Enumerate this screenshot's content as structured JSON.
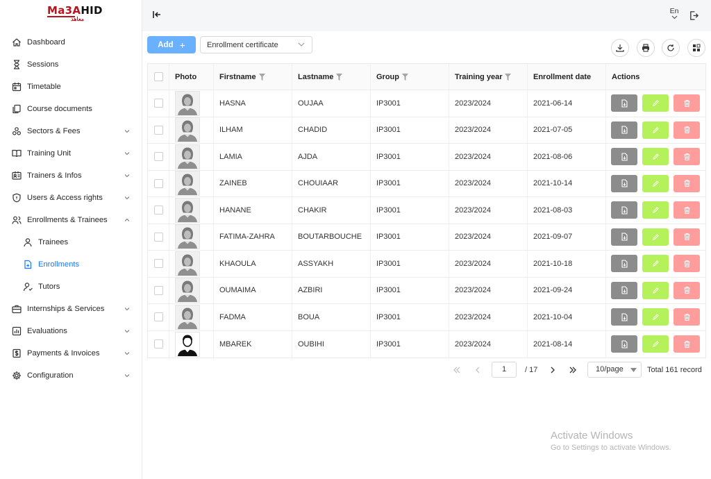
{
  "app": {
    "logo_text": "MA3AHID",
    "logo_arabic": "معاهد"
  },
  "sidebar": {
    "items": [
      {
        "label": "Dashboard",
        "icon": "home-icon",
        "expandable": false
      },
      {
        "label": "Sessions",
        "icon": "hourglass-icon",
        "expandable": false
      },
      {
        "label": "Timetable",
        "icon": "calendar-icon",
        "expandable": false
      },
      {
        "label": "Course documents",
        "icon": "documents-icon",
        "expandable": false
      },
      {
        "label": "Sectors & Fees",
        "icon": "clusters-icon",
        "expandable": true
      },
      {
        "label": "Training Unit",
        "icon": "book-icon",
        "expandable": true
      },
      {
        "label": "Trainers & Infos",
        "icon": "id-card-icon",
        "expandable": true
      },
      {
        "label": "Users & Access rights",
        "icon": "shield-icon",
        "expandable": true
      },
      {
        "label": "Enrollments & Trainees",
        "icon": "users-icon",
        "expandable": true,
        "expanded": true
      },
      {
        "label": "Trainees",
        "icon": "user-icon",
        "sub": true
      },
      {
        "label": "Enrollments",
        "icon": "enroll-icon",
        "sub": true,
        "active": true
      },
      {
        "label": "Tutors",
        "icon": "tutor-icon",
        "sub": true
      },
      {
        "label": "Internships & Services",
        "icon": "briefcase-icon",
        "expandable": true
      },
      {
        "label": "Evaluations",
        "icon": "chart-icon",
        "expandable": true
      },
      {
        "label": "Payments & Invoices",
        "icon": "dollar-icon",
        "expandable": true
      },
      {
        "label": "Configuration",
        "icon": "gear-icon",
        "expandable": true
      }
    ]
  },
  "topbar": {
    "language": "En"
  },
  "toolbar": {
    "add_label": "Add",
    "select_value": "Enrollment certificate"
  },
  "table": {
    "headers": [
      "Photo",
      "Firstname",
      "Lastname",
      "Group",
      "Training year",
      "Enrollment date",
      "Actions"
    ],
    "rows": [
      {
        "firstname": "HASNA",
        "lastname": "OUJAA",
        "group": "IP3001",
        "year": "2023/2024",
        "date": "2021-06-14",
        "photo": "female"
      },
      {
        "firstname": "ILHAM",
        "lastname": "CHADID",
        "group": "IP3001",
        "year": "2023/2024",
        "date": "2021-07-05",
        "photo": "female"
      },
      {
        "firstname": "LAMIA",
        "lastname": "AJDA",
        "group": "IP3001",
        "year": "2023/2024",
        "date": "2021-08-06",
        "photo": "female"
      },
      {
        "firstname": "ZAINEB",
        "lastname": "CHOUIAAR",
        "group": "IP3001",
        "year": "2023/2024",
        "date": "2021-10-14",
        "photo": "female"
      },
      {
        "firstname": "HANANE",
        "lastname": "CHAKIR",
        "group": "IP3001",
        "year": "2023/2024",
        "date": "2021-08-03",
        "photo": "female"
      },
      {
        "firstname": "FATIMA-ZAHRA",
        "lastname": "BOUTARBOUCHE",
        "group": "IP3001",
        "year": "2023/2024",
        "date": "2021-09-07",
        "photo": "female"
      },
      {
        "firstname": "KHAOULA",
        "lastname": "ASSYAKH",
        "group": "IP3001",
        "year": "2023/2024",
        "date": "2021-10-18",
        "photo": "female"
      },
      {
        "firstname": "OUMAIMA",
        "lastname": "AZBIRI",
        "group": "IP3001",
        "year": "2023/2024",
        "date": "2021-09-24",
        "photo": "female"
      },
      {
        "firstname": "FADMA",
        "lastname": "BOUA",
        "group": "IP3001",
        "year": "2023/2024",
        "date": "2021-10-04",
        "photo": "female"
      },
      {
        "firstname": "MBAREK",
        "lastname": "OUBIHI",
        "group": "IP3001",
        "year": "2023/2024",
        "date": "2021-08-14",
        "photo": "male"
      }
    ]
  },
  "pagination": {
    "current_page": "1",
    "total_pages": "/ 17",
    "page_size": "10/page",
    "total_records": "Total 161 record"
  },
  "watermark": {
    "title": "Activate Windows",
    "subtitle": "Go to Settings to activate Windows."
  },
  "colors": {
    "primary": "#1677ff",
    "add_button": "#69b1ff",
    "doc_button": "#8c8c8c",
    "edit_button": "#b5f15a",
    "delete_button": "#ff9c9c"
  }
}
